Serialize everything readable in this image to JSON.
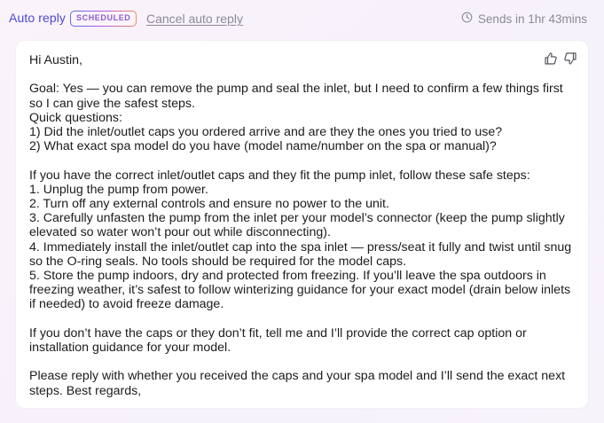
{
  "header": {
    "auto_reply_label": "Auto reply",
    "badge": "SCHEDULED",
    "cancel_label": "Cancel auto reply",
    "sends_text": "Sends in 1hr 43mins"
  },
  "icons": {
    "clock": "clock-icon",
    "thumbs_up": "thumbs-up-icon",
    "thumbs_down": "thumbs-down-icon"
  },
  "colors": {
    "accent": "#4a4ad8",
    "muted": "#8b8b96",
    "text": "#1c1c1f"
  },
  "message": {
    "greeting": "Hi Austin,",
    "goal": "Goal: Yes — you can remove the pump and seal the inlet, but I need to confirm a few things first so I can give the safest steps.",
    "quick_questions": "Quick questions:",
    "q1": "1) Did the inlet/outlet caps you ordered arrive and are they the ones you tried to use?",
    "q2": "2) What exact spa model do you have (model name/number on the spa or manual)?",
    "steps_intro": "If you have the correct inlet/outlet caps and they fit the pump inlet, follow these safe steps:",
    "step1": "1. Unplug the pump from power.",
    "step2": "2. Turn off any external controls and ensure no power to the unit.",
    "step3": "3. Carefully unfasten the pump from the inlet per your model’s connector (keep the pump slightly elevated so water won’t pour out while disconnecting).",
    "step4": "4. Immediately install the inlet/outlet cap into the spa inlet — press/seat it fully and twist until snug so the O-ring seals. No tools should be required for the model caps.",
    "step5": "5. Store the pump indoors, dry and protected from freezing. If you’ll leave the spa outdoors in freezing weather, it’s safest to follow winterizing guidance for your exact model (drain below inlets if needed) to avoid freeze damage.",
    "no_caps": "If you don’t have the caps or they don’t fit, tell me and I’ll provide the correct cap option or installation guidance for your model.",
    "closing": "Please reply with whether you received the caps and your spa model and I’ll send the exact next steps.  Best regards,"
  }
}
